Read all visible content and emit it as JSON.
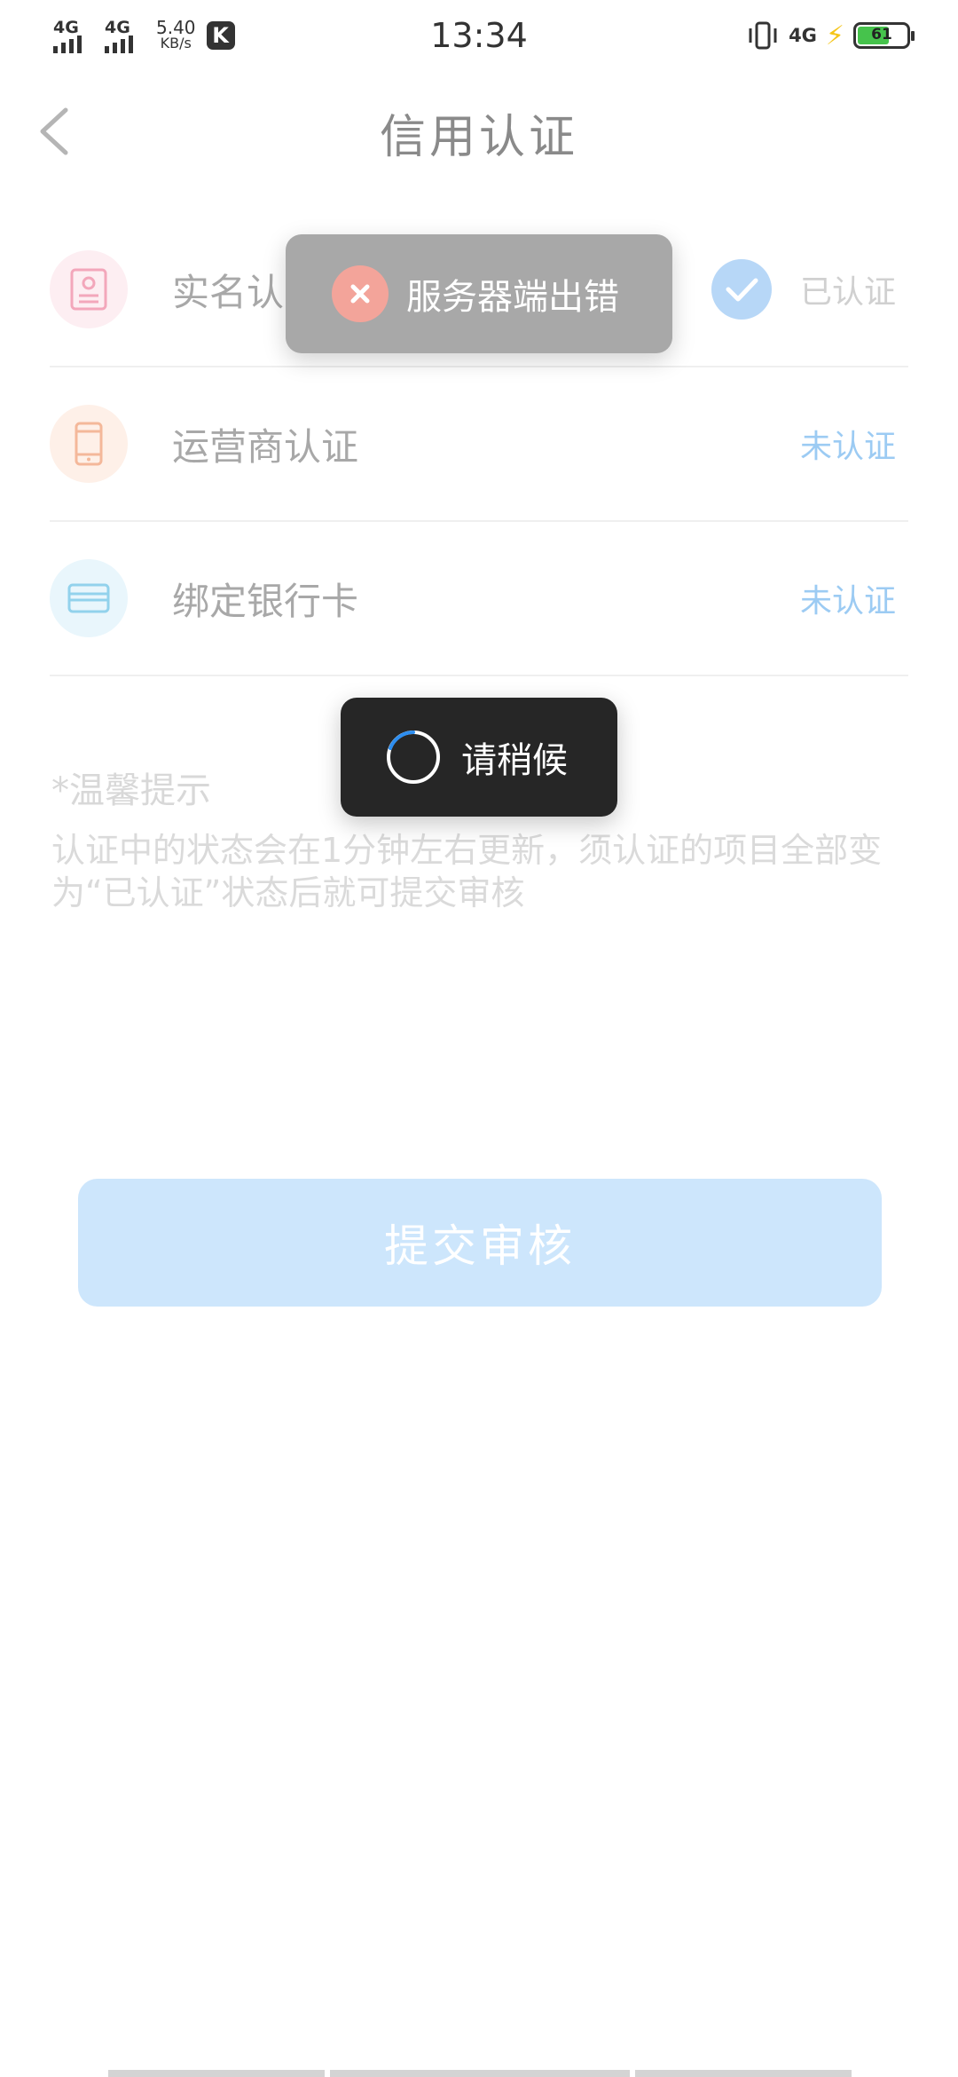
{
  "status_bar": {
    "sim1": "4G",
    "sim2": "4G",
    "speed_value": "5.40",
    "speed_unit": "KB/s",
    "k_badge": "K",
    "time": "13:34",
    "network": "4G",
    "battery": "61"
  },
  "header": {
    "title": "信用认证",
    "back_icon": "chevron-left-icon"
  },
  "rows": [
    {
      "label": "实名认证",
      "status": "已认证",
      "icon": "id-card-icon",
      "verified": true
    },
    {
      "label": "运营商认证",
      "status": "未认证",
      "icon": "phone-icon",
      "verified": false
    },
    {
      "label": "绑定银行卡",
      "status": "未认证",
      "icon": "bank-card-icon",
      "verified": false
    }
  ],
  "tips": {
    "title": "*温馨提示",
    "body": "认证中的状态会在1分钟左右更新，须认证的项目全部变为“已认证”状态后就可提交审核"
  },
  "submit_label": "提交审核",
  "toast_error": "服务器端出错",
  "toast_loading": "请稍候",
  "colors": {
    "accent": "#4ea7f2",
    "unverified": "#9ccbf3",
    "toast_error_bg": "#a8a8a8",
    "toast_loading_bg": "#262626",
    "submit_bg": "#cde6fc"
  }
}
